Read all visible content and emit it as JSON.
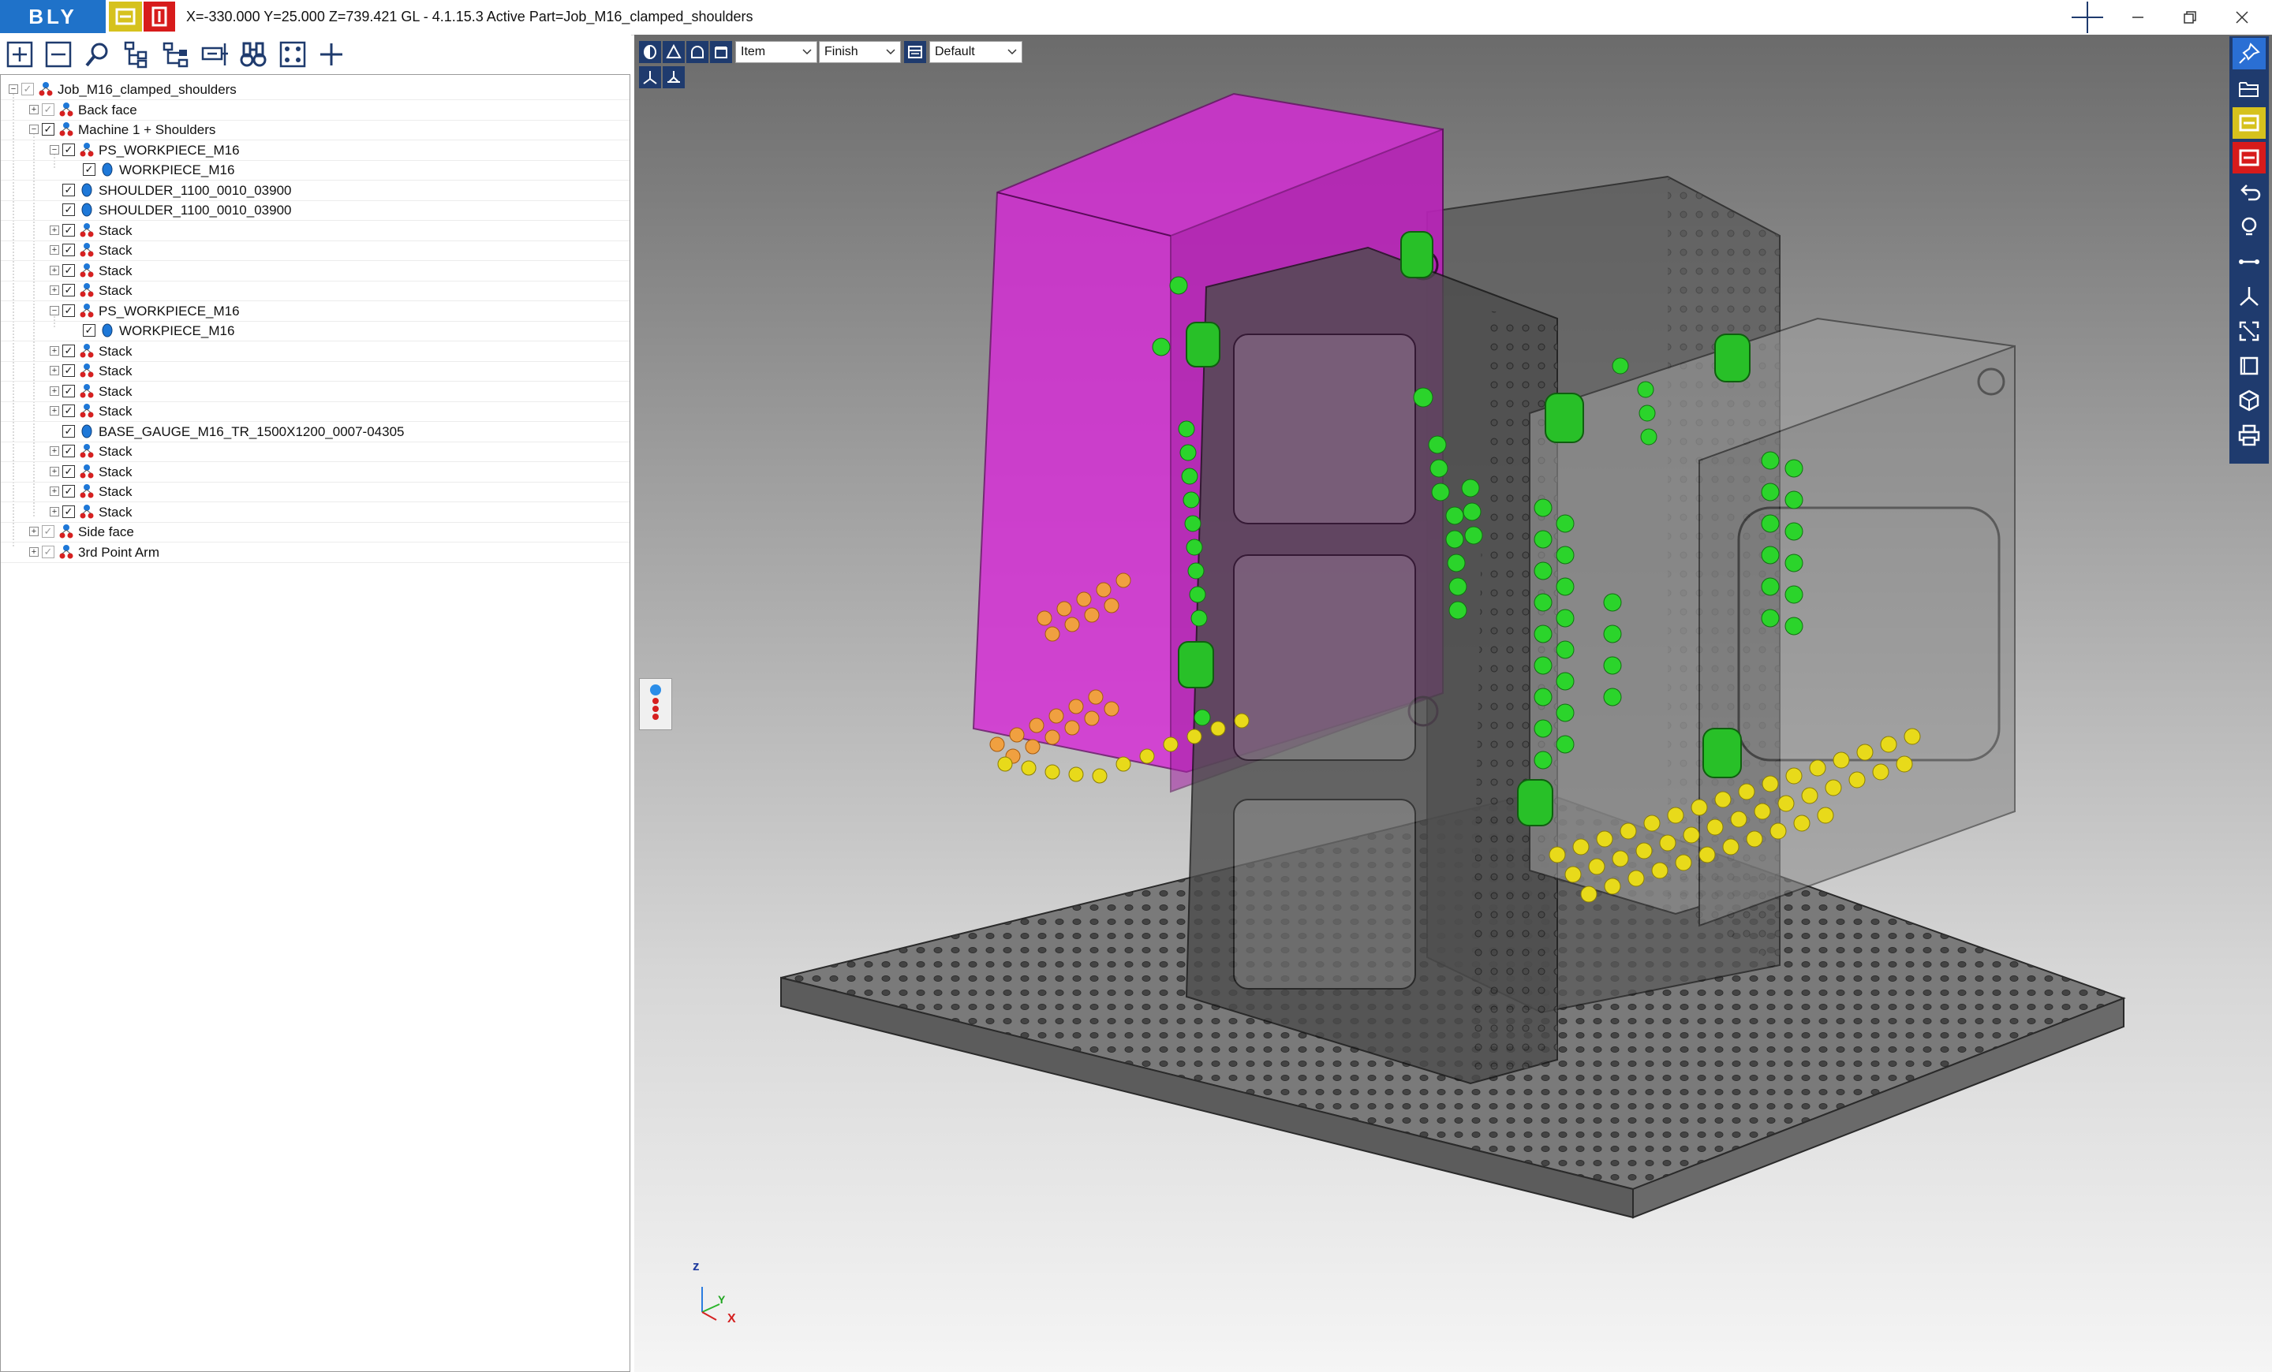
{
  "app": {
    "logo_text": "BLY",
    "title": "X=-330.000 Y=25.000 Z=739.421   GL - 4.1.15.3 Active Part=Job_M16_clamped_shoulders"
  },
  "window_controls": [
    "minimize-icon",
    "restore-icon",
    "close-icon"
  ],
  "toolbar": {
    "icons": [
      "expand-all-icon",
      "collapse-all-icon",
      "search-icon",
      "tree-structure-icon",
      "hierarchy-icon",
      "dimension-icon",
      "binoculars-icon",
      "select-frame-icon",
      "add-icon"
    ]
  },
  "tree": {
    "items": [
      {
        "label": "Job_M16_clamped_shoulders",
        "level": 0,
        "expander": "minus",
        "check": "grey",
        "icon": "assembly"
      },
      {
        "label": "Back face",
        "level": 1,
        "expander": "plus",
        "check": "grey",
        "icon": "assembly"
      },
      {
        "label": "Machine 1 + Shoulders",
        "level": 1,
        "expander": "minus",
        "check": "checked",
        "icon": "assembly"
      },
      {
        "label": "PS_WORKPIECE_M16",
        "level": 2,
        "expander": "minus",
        "check": "checked",
        "icon": "assembly"
      },
      {
        "label": "WORKPIECE_M16",
        "level": 3,
        "expander": "",
        "check": "checked",
        "icon": "part"
      },
      {
        "label": "SHOULDER_1100_0010_03900",
        "level": 2,
        "expander": "",
        "check": "checked",
        "icon": "part"
      },
      {
        "label": "SHOULDER_1100_0010_03900",
        "level": 2,
        "expander": "",
        "check": "checked",
        "icon": "part"
      },
      {
        "label": "Stack",
        "level": 2,
        "expander": "plus",
        "check": "checked",
        "icon": "assembly"
      },
      {
        "label": "Stack",
        "level": 2,
        "expander": "plus",
        "check": "checked",
        "icon": "assembly"
      },
      {
        "label": "Stack",
        "level": 2,
        "expander": "plus",
        "check": "checked",
        "icon": "assembly"
      },
      {
        "label": "Stack",
        "level": 2,
        "expander": "plus",
        "check": "checked",
        "icon": "assembly"
      },
      {
        "label": "PS_WORKPIECE_M16",
        "level": 2,
        "expander": "minus",
        "check": "checked",
        "icon": "assembly"
      },
      {
        "label": "WORKPIECE_M16",
        "level": 3,
        "expander": "",
        "check": "checked",
        "icon": "part"
      },
      {
        "label": "Stack",
        "level": 2,
        "expander": "plus",
        "check": "checked",
        "icon": "assembly"
      },
      {
        "label": "Stack",
        "level": 2,
        "expander": "plus",
        "check": "checked",
        "icon": "assembly"
      },
      {
        "label": "Stack",
        "level": 2,
        "expander": "plus",
        "check": "checked",
        "icon": "assembly"
      },
      {
        "label": "Stack",
        "level": 2,
        "expander": "plus",
        "check": "checked",
        "icon": "assembly"
      },
      {
        "label": "BASE_GAUGE_M16_TR_1500X1200_0007-04305",
        "level": 2,
        "expander": "",
        "check": "checked",
        "icon": "part"
      },
      {
        "label": "Stack",
        "level": 2,
        "expander": "plus",
        "check": "checked",
        "icon": "assembly"
      },
      {
        "label": "Stack",
        "level": 2,
        "expander": "plus",
        "check": "checked",
        "icon": "assembly"
      },
      {
        "label": "Stack",
        "level": 2,
        "expander": "plus",
        "check": "checked",
        "icon": "assembly"
      },
      {
        "label": "Stack",
        "level": 2,
        "expander": "plus",
        "check": "checked",
        "icon": "assembly"
      },
      {
        "label": "Side face",
        "level": 1,
        "expander": "plus",
        "check": "grey",
        "icon": "assembly"
      },
      {
        "label": "3rd Point Arm",
        "level": 1,
        "expander": "plus",
        "check": "grey",
        "icon": "assembly"
      }
    ]
  },
  "viewport": {
    "render_modes": [
      "solid-shading-icon",
      "wireframe-icon",
      "hidden-line-icon",
      "transparent-icon"
    ],
    "select_item": "Item",
    "select_finish": "Finish",
    "select_default": "Default",
    "axes": {
      "z": "z",
      "y": "Y",
      "x": "X"
    }
  },
  "right_rail": {
    "icons": [
      "pin-icon",
      "open-folder-icon",
      "yellow-badge-icon",
      "red-badge-icon",
      "undo-icon",
      "lightbulb-icon",
      "measure-icon",
      "axis-icon",
      "fit-view-icon",
      "frame-icon",
      "cube-icon",
      "print-icon"
    ]
  },
  "colors": {
    "brand_blue": "#1f72c9",
    "rail_navy": "#1f3b6e",
    "accent_yellow": "#d6c21d",
    "accent_red": "#d71b1b",
    "workpiece_magenta": "#d62ad6"
  }
}
